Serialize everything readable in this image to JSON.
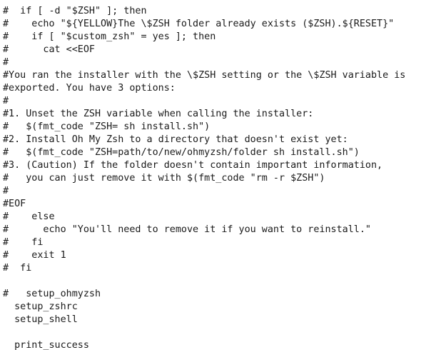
{
  "editor": {
    "lines": [
      "#  if [ -d \"$ZSH\" ]; then",
      "#    echo \"${YELLOW}The \\$ZSH folder already exists ($ZSH).${RESET}\"",
      "#    if [ \"$custom_zsh\" = yes ]; then",
      "#      cat <<EOF",
      "#",
      "#You ran the installer with the \\$ZSH setting or the \\$ZSH variable is",
      "#exported. You have 3 options:",
      "#",
      "#1. Unset the ZSH variable when calling the installer:",
      "#   $(fmt_code \"ZSH= sh install.sh\")",
      "#2. Install Oh My Zsh to a directory that doesn't exist yet:",
      "#   $(fmt_code \"ZSH=path/to/new/ohmyzsh/folder sh install.sh\")",
      "#3. (Caution) If the folder doesn't contain important information,",
      "#   you can just remove it with $(fmt_code \"rm -r $ZSH\")",
      "#",
      "#EOF",
      "#    else",
      "#      echo \"You'll need to remove it if you want to reinstall.\"",
      "#    fi",
      "#    exit 1",
      "#  fi",
      "",
      "#   setup_ohmyzsh",
      "  setup_zshrc",
      "  setup_shell",
      "",
      "  print_success"
    ]
  }
}
